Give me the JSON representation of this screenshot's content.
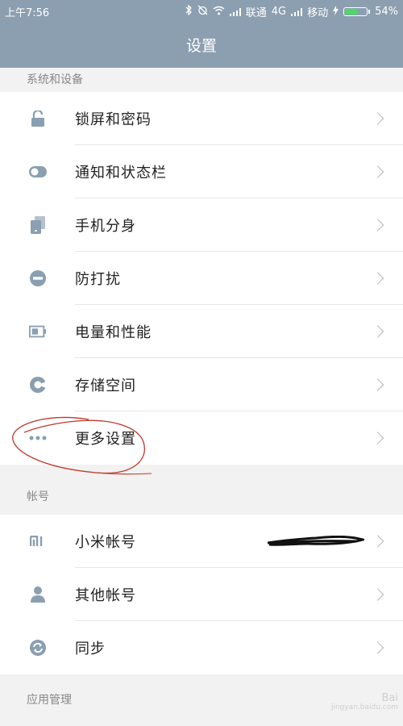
{
  "status": {
    "time": "上午7:56",
    "carrier1": "联通",
    "network": "4G",
    "carrier2": "移动",
    "battery": "54%",
    "battery_level": 0.54
  },
  "header": {
    "title": "设置"
  },
  "sections": {
    "system": "系统和设备",
    "account": "帐号",
    "apps": "应用管理"
  },
  "system_items": [
    {
      "label": "锁屏和密码",
      "icon": "lock-icon"
    },
    {
      "label": "通知和状态栏",
      "icon": "toggle-icon"
    },
    {
      "label": "手机分身",
      "icon": "phone-clone-icon"
    },
    {
      "label": "防打扰",
      "icon": "do-not-disturb-icon"
    },
    {
      "label": "电量和性能",
      "icon": "battery-icon"
    },
    {
      "label": "存储空间",
      "icon": "storage-icon"
    },
    {
      "label": "更多设置",
      "icon": "more-icon"
    }
  ],
  "account_items": [
    {
      "label": "小米帐号",
      "icon": "mi-icon"
    },
    {
      "label": "其他帐号",
      "icon": "person-icon"
    },
    {
      "label": "同步",
      "icon": "sync-icon"
    }
  ],
  "colors": {
    "header_bg": "#8c9fb0",
    "icon_color": "#8a9fb1",
    "annotation_red": "#c0392b"
  },
  "watermark": {
    "brand": "Bai",
    "sub": "jingyan.baidu.com"
  }
}
